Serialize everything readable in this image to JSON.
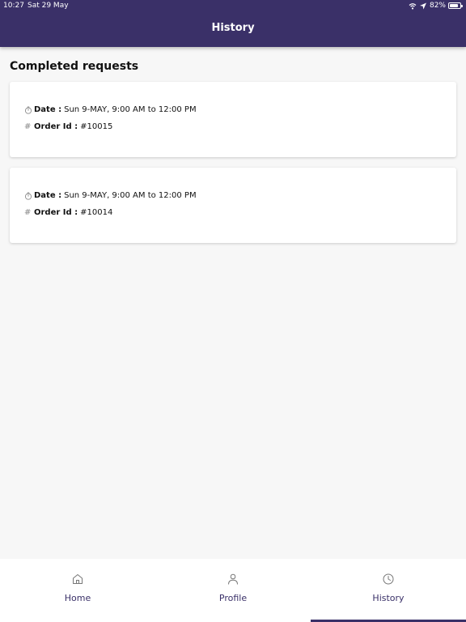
{
  "status_bar": {
    "time": "10:27",
    "date": "Sat 29 May",
    "battery": "82%",
    "battery_level": 0.82
  },
  "header": {
    "title": "History"
  },
  "section": {
    "title": "Completed requests"
  },
  "requests": [
    {
      "date_label": "Date :",
      "date_value": "Sun 9-MAY, 9:00 AM to 12:00 PM",
      "order_label": "Order Id :",
      "order_value": "#10015"
    },
    {
      "date_label": "Date :",
      "date_value": "Sun 9-MAY, 9:00 AM to 12:00 PM",
      "order_label": "Order Id :",
      "order_value": "#10014"
    }
  ],
  "nav": {
    "items": [
      {
        "label": "Home",
        "icon": "home-icon"
      },
      {
        "label": "Profile",
        "icon": "profile-icon"
      },
      {
        "label": "History",
        "icon": "history-icon"
      }
    ],
    "active": "History"
  },
  "colors": {
    "primary": "#3a3068",
    "background": "#f7f7f7",
    "card": "#ffffff"
  }
}
